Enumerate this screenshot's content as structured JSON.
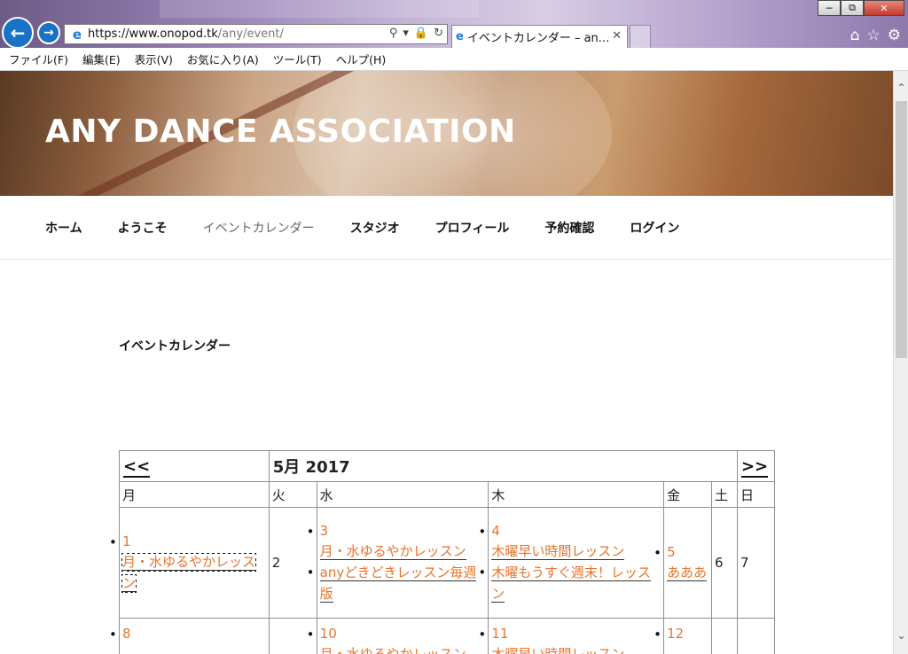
{
  "browser": {
    "address_host": "https://www.onopod.tk",
    "address_path": "/any/event/",
    "tab_title": "イベントカレンダー – an...",
    "menu": [
      "ファイル(F)",
      "編集(E)",
      "表示(V)",
      "お気に入り(A)",
      "ツール(T)",
      "ヘルプ(H)"
    ]
  },
  "site": {
    "title": "ANY DANCE ASSOCIATION",
    "nav": [
      "ホーム",
      "ようこそ",
      "イベントカレンダー",
      "スタジオ",
      "プロフィール",
      "予約確認",
      "ログイン"
    ],
    "current_nav": "イベントカレンダー"
  },
  "page": {
    "heading": "イベントカレンダー"
  },
  "calendar": {
    "prev_label": "<<",
    "next_label": ">>",
    "month_label": "5月 2017",
    "weekdays": [
      "月",
      "火",
      "水",
      "木",
      "金",
      "土",
      "日"
    ],
    "week1": {
      "mon": {
        "day": "1",
        "events": [
          "月・水ゆるやかレッスン"
        ]
      },
      "tue": {
        "day": "2"
      },
      "wed": {
        "day": "3",
        "events": [
          "月・水ゆるやかレッスン",
          "anyどきどきレッスン毎週版"
        ]
      },
      "thu": {
        "day": "4",
        "events": [
          "木曜早い時間レッスン",
          "木曜もうすぐ週末！レッスン"
        ]
      },
      "fri": {
        "day": "5",
        "events": [
          "あああ"
        ]
      },
      "sat": {
        "day": "6"
      },
      "sun": {
        "day": "7"
      }
    },
    "week2": {
      "mon": {
        "day": "8"
      },
      "wed": {
        "day": "10",
        "events": [
          "月・水ゆるやかレッスン"
        ]
      },
      "thu": {
        "day": "11",
        "events": [
          "木曜早い時間レッスン"
        ]
      },
      "fri": {
        "day": "12"
      }
    }
  },
  "colors": {
    "link": "#e8742b",
    "ie_blue": "#1a72c6"
  }
}
